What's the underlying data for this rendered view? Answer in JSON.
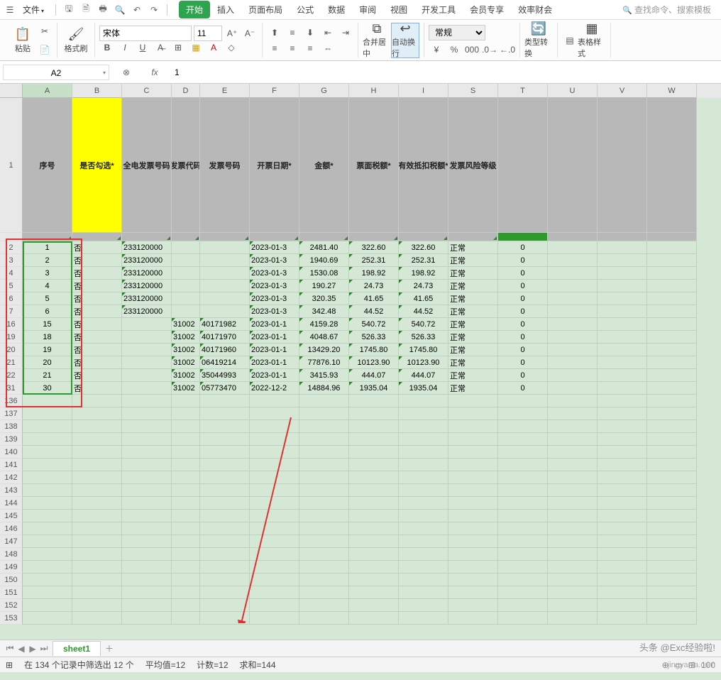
{
  "menu": {
    "file": "文件",
    "tabs": [
      "开始",
      "插入",
      "页面布局",
      "公式",
      "数据",
      "审阅",
      "视图",
      "开发工具",
      "会员专享",
      "效率财会"
    ],
    "search_placeholder": "查找命令、搜索模板"
  },
  "ribbon": {
    "paste": "粘贴",
    "format_painter": "格式刷",
    "font_name": "宋体",
    "font_size": "11",
    "merge": "合并居中",
    "wrap": "自动换行",
    "number_fmt": "常规",
    "type_convert": "类型转换",
    "table_style": "表格样式"
  },
  "namebox": "A2",
  "formula": "1",
  "columns": [
    "A",
    "B",
    "C",
    "D",
    "E",
    "F",
    "G",
    "H",
    "I",
    "S",
    "T",
    "U",
    "V",
    "W"
  ],
  "headers": {
    "A": "序号",
    "B": "是否勾选*",
    "C": "全电发票号码",
    "D": "发票代码",
    "E": "发票号码",
    "F": "开票日期*",
    "G": "金额*",
    "H": "票面税额*",
    "I": "有效抵扣税额*",
    "S": "发票风险等级"
  },
  "rows": [
    {
      "rn": "2",
      "A": "1",
      "B": "否",
      "C": "233120000",
      "F": "2023-01-3",
      "G": "2481.40",
      "H": "322.60",
      "I": "322.60",
      "S": "正常",
      "T": "0"
    },
    {
      "rn": "3",
      "A": "2",
      "B": "否",
      "C": "233120000",
      "F": "2023-01-3",
      "G": "1940.69",
      "H": "252.31",
      "I": "252.31",
      "S": "正常",
      "T": "0"
    },
    {
      "rn": "4",
      "A": "3",
      "B": "否",
      "C": "233120000",
      "F": "2023-01-3",
      "G": "1530.08",
      "H": "198.92",
      "I": "198.92",
      "S": "正常",
      "T": "0"
    },
    {
      "rn": "5",
      "A": "4",
      "B": "否",
      "C": "233120000",
      "F": "2023-01-3",
      "G": "190.27",
      "H": "24.73",
      "I": "24.73",
      "S": "正常",
      "T": "0"
    },
    {
      "rn": "6",
      "A": "5",
      "B": "否",
      "C": "233120000",
      "F": "2023-01-3",
      "G": "320.35",
      "H": "41.65",
      "I": "41.65",
      "S": "正常",
      "T": "0"
    },
    {
      "rn": "7",
      "A": "6",
      "B": "否",
      "C": "233120000",
      "F": "2023-01-3",
      "G": "342.48",
      "H": "44.52",
      "I": "44.52",
      "S": "正常",
      "T": "0"
    },
    {
      "rn": "16",
      "A": "15",
      "B": "否",
      "D": "31002",
      "E": "40171982",
      "F": "2023-01-1",
      "G": "4159.28",
      "H": "540.72",
      "I": "540.72",
      "S": "正常",
      "T": "0"
    },
    {
      "rn": "19",
      "A": "18",
      "B": "否",
      "D": "31002",
      "E": "40171970",
      "F": "2023-01-1",
      "G": "4048.67",
      "H": "526.33",
      "I": "526.33",
      "S": "正常",
      "T": "0"
    },
    {
      "rn": "20",
      "A": "19",
      "B": "否",
      "D": "31002",
      "E": "40171960",
      "F": "2023-01-1",
      "G": "13429.20",
      "H": "1745.80",
      "I": "1745.80",
      "S": "正常",
      "T": "0"
    },
    {
      "rn": "21",
      "A": "20",
      "B": "否",
      "D": "31002",
      "E": "06419214",
      "F": "2023-01-1",
      "G": "77876.10",
      "H": "10123.90",
      "I": "10123.90",
      "S": "正常",
      "T": "0"
    },
    {
      "rn": "22",
      "A": "21",
      "B": "否",
      "D": "31002",
      "E": "35044993",
      "F": "2023-01-1",
      "G": "3415.93",
      "H": "444.07",
      "I": "444.07",
      "S": "正常",
      "T": "0"
    },
    {
      "rn": "31",
      "A": "30",
      "B": "否",
      "D": "31002",
      "E": "05773470",
      "F": "2022-12-2",
      "G": "14884.96",
      "H": "1935.04",
      "I": "1935.04",
      "S": "正常",
      "T": "0"
    }
  ],
  "empty_rows": [
    "136",
    "137",
    "138",
    "139",
    "140",
    "141",
    "142",
    "143",
    "144",
    "145",
    "146",
    "147",
    "148",
    "149",
    "150",
    "151",
    "152",
    "153"
  ],
  "sheet": {
    "name": "sheet1"
  },
  "status": {
    "filter": "在 134 个记录中筛选出 12 个",
    "avg": "平均值=12",
    "count": "计数=12",
    "sum": "求和=144",
    "zoom": "100"
  },
  "watermark1": "头条 @Exc经验啦!",
  "watermark2": "jingyanla.com"
}
